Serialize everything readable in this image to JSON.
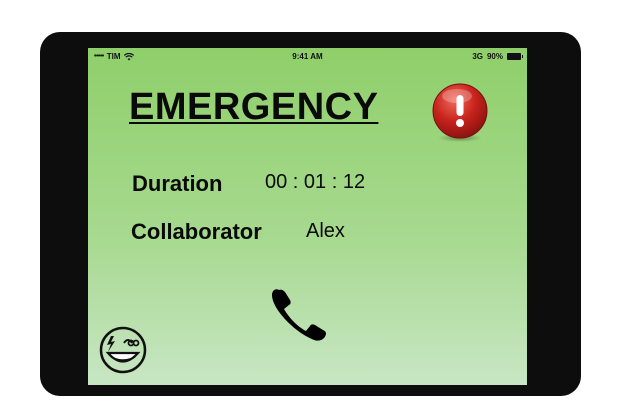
{
  "status_bar": {
    "signal_dots": "•••••",
    "carrier": "TIM",
    "time": "9:41 AM",
    "network": "3G",
    "battery": "90%"
  },
  "screen": {
    "title": "EMERGENCY",
    "duration_label": "Duration",
    "duration_value": "00 : 01 : 12",
    "collaborator_label": "Collaborator",
    "collaborator_value": "Alex"
  },
  "icons": {
    "alert": "exclamation-alert-icon",
    "call": "phone-icon",
    "mascot": "smiley-mascot-icon",
    "wifi": "wifi-icon",
    "battery": "battery-icon"
  },
  "colors": {
    "screen_top": "#8fcf6a",
    "screen_bottom": "#c8e6c4",
    "alert_red": "#c8231c",
    "device_frame": "#0d0d0d"
  }
}
